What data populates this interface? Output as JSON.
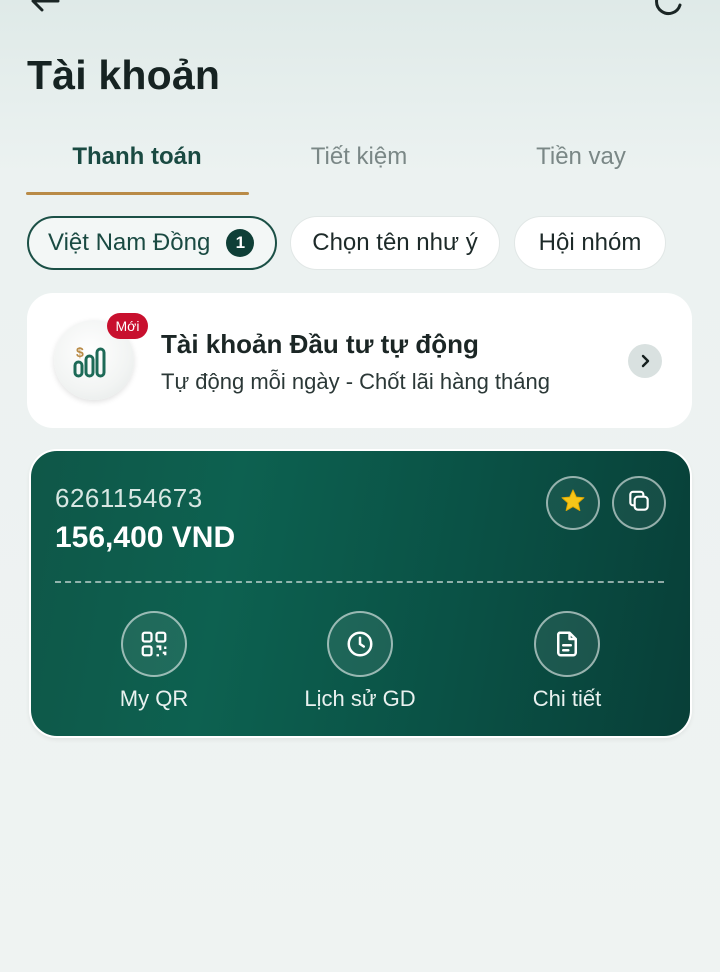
{
  "header": {
    "title": "Tài khoản"
  },
  "tabs": [
    {
      "label": "Thanh toán",
      "active": true
    },
    {
      "label": "Tiết kiệm",
      "active": false
    },
    {
      "label": "Tiền vay",
      "active": false
    }
  ],
  "chips": [
    {
      "label": "Việt Nam Đồng",
      "count": "1",
      "selected": true
    },
    {
      "label": "Chọn tên như ý"
    },
    {
      "label": "Hội nhóm"
    }
  ],
  "promo": {
    "badge": "Mới",
    "title": "Tài khoản Đầu tư tự động",
    "subtitle": "Tự động mỗi ngày - Chốt lãi hàng tháng",
    "logo_icon": "money-growth-icon"
  },
  "account": {
    "number": "6261154673",
    "balance": "156,400 VND",
    "actions": [
      {
        "label": "My QR",
        "icon": "qr-code-icon"
      },
      {
        "label": "Lịch sử GD",
        "icon": "clock-icon"
      },
      {
        "label": "Chi tiết",
        "icon": "document-icon"
      }
    ]
  },
  "colors": {
    "brand_green": "#0d6150",
    "accent_gold": "#b98b47",
    "star_yellow": "#f5c518",
    "badge_red": "#c8102e"
  }
}
